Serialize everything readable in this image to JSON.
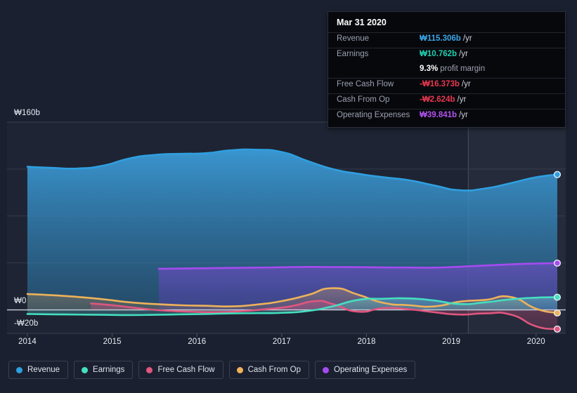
{
  "tooltip": {
    "date": "Mar 31 2020",
    "rows": [
      {
        "key": "Revenue",
        "value": "₩115.306b",
        "suffix": "/yr",
        "color": "#3ba6e8"
      },
      {
        "key": "Earnings",
        "value": "₩10.762b",
        "suffix": "/yr",
        "color": "#1fd0b0"
      },
      {
        "key": "Free Cash Flow",
        "value": "-₩16.373b",
        "suffix": "/yr",
        "color": "#e8384f"
      },
      {
        "key": "Cash From Op",
        "value": "-₩2.624b",
        "suffix": "/yr",
        "color": "#e8384f"
      },
      {
        "key": "Operating Expenses",
        "value": "₩39.841b",
        "suffix": "/yr",
        "color": "#b152f0"
      }
    ],
    "margin_value": "9.3%",
    "margin_label": "profit margin"
  },
  "legend": [
    {
      "label": "Revenue",
      "color": "#2f9fe0"
    },
    {
      "label": "Earnings",
      "color": "#45dfc0"
    },
    {
      "label": "Free Cash Flow",
      "color": "#e0567f"
    },
    {
      "label": "Cash From Op",
      "color": "#eeb25a"
    },
    {
      "label": "Operating Expenses",
      "color": "#a64bf0"
    }
  ],
  "chart_data": {
    "type": "area",
    "title": "",
    "xlabel": "",
    "ylabel": "",
    "currency": "₩",
    "units": "billions (b)",
    "grid": true,
    "legend_position": "bottom",
    "ylim": [
      -20,
      160
    ],
    "y_ticks": [
      {
        "label": "₩160b",
        "value": 160
      },
      {
        "label": "₩0",
        "value": 0
      },
      {
        "label": "-₩20b",
        "value": -20
      }
    ],
    "x_ticks": [
      "2014",
      "2015",
      "2016",
      "2017",
      "2018",
      "2019",
      "2020"
    ],
    "xlim": [
      "2013.75",
      "2020.35"
    ],
    "highlight_band": {
      "from": "2019.2",
      "to": "2020.35",
      "note": "shaded recent period"
    },
    "series": [
      {
        "name": "Revenue",
        "color": "#2f9fe0",
        "x": [
          2014.0,
          2014.3,
          2014.6,
          2014.9,
          2015.2,
          2015.5,
          2015.8,
          2016.1,
          2016.4,
          2016.7,
          2017.0,
          2017.3,
          2017.6,
          2017.9,
          2018.2,
          2018.5,
          2018.8,
          2019.1,
          2019.4,
          2019.7,
          2020.0,
          2020.25
        ],
        "values": [
          122,
          121,
          120.5,
          123,
          129,
          132,
          133,
          133.5,
          136,
          136.5,
          134.5,
          127,
          120,
          116,
          113,
          110.5,
          106,
          102,
          103.5,
          108,
          113,
          115.306
        ]
      },
      {
        "name": "Earnings",
        "color": "#45dfc0",
        "x": [
          2014.0,
          2014.3,
          2014.6,
          2014.9,
          2015.2,
          2015.5,
          2015.8,
          2016.1,
          2016.4,
          2016.7,
          2017.0,
          2017.3,
          2017.6,
          2017.9,
          2018.2,
          2018.5,
          2018.8,
          2019.1,
          2019.4,
          2019.7,
          2020.0,
          2020.25
        ],
        "values": [
          -3.5,
          -3.8,
          -4.0,
          -4.2,
          -4.4,
          -4.2,
          -3.8,
          -3.5,
          -3.0,
          -2.8,
          -2.5,
          -1.0,
          3.0,
          8.5,
          9.5,
          9.8,
          8.0,
          5.0,
          6.5,
          9.0,
          10.4,
          10.762
        ]
      },
      {
        "name": "Free Cash Flow",
        "color": "#e0567f",
        "x": [
          2014.75,
          2015.0,
          2015.3,
          2015.6,
          2015.9,
          2016.2,
          2016.5,
          2016.8,
          2017.1,
          2017.4,
          2017.6,
          2017.9,
          2018.2,
          2018.5,
          2018.8,
          2019.1,
          2019.4,
          2019.7,
          2020.0,
          2020.25
        ],
        "values": [
          5.5,
          4.0,
          1.5,
          -0.5,
          -1.5,
          -2.0,
          -1.2,
          0.5,
          3.0,
          7.5,
          5.0,
          -1.5,
          1.5,
          0.5,
          -2.0,
          -4.0,
          -3.0,
          -4.0,
          -14.0,
          -16.373
        ]
      },
      {
        "name": "Cash From Op",
        "color": "#eeb25a",
        "x": [
          2014.0,
          2014.3,
          2014.6,
          2014.9,
          2015.2,
          2015.5,
          2015.8,
          2016.1,
          2016.4,
          2016.7,
          2017.0,
          2017.3,
          2017.6,
          2017.9,
          2018.2,
          2018.5,
          2018.8,
          2019.1,
          2019.4,
          2019.7,
          2020.0,
          2020.25
        ],
        "values": [
          13.5,
          12.5,
          11.0,
          9.0,
          6.5,
          5.0,
          4.0,
          3.5,
          3.0,
          4.5,
          7.5,
          12.5,
          18.5,
          13.0,
          6.0,
          4.0,
          3.0,
          7.0,
          8.5,
          11.0,
          1.0,
          -2.624
        ]
      },
      {
        "name": "Operating Expenses",
        "color": "#a64bf0",
        "x": [
          2015.55,
          2015.8,
          2016.1,
          2016.4,
          2016.7,
          2017.0,
          2017.3,
          2017.6,
          2017.9,
          2018.2,
          2018.5,
          2018.8,
          2019.1,
          2019.4,
          2019.7,
          2020.0,
          2020.25
        ],
        "values": [
          35.0,
          35.2,
          35.5,
          35.8,
          36.0,
          36.3,
          36.6,
          36.5,
          36.4,
          36.2,
          36.1,
          36.0,
          36.8,
          37.8,
          38.8,
          39.5,
          39.841
        ]
      }
    ]
  }
}
